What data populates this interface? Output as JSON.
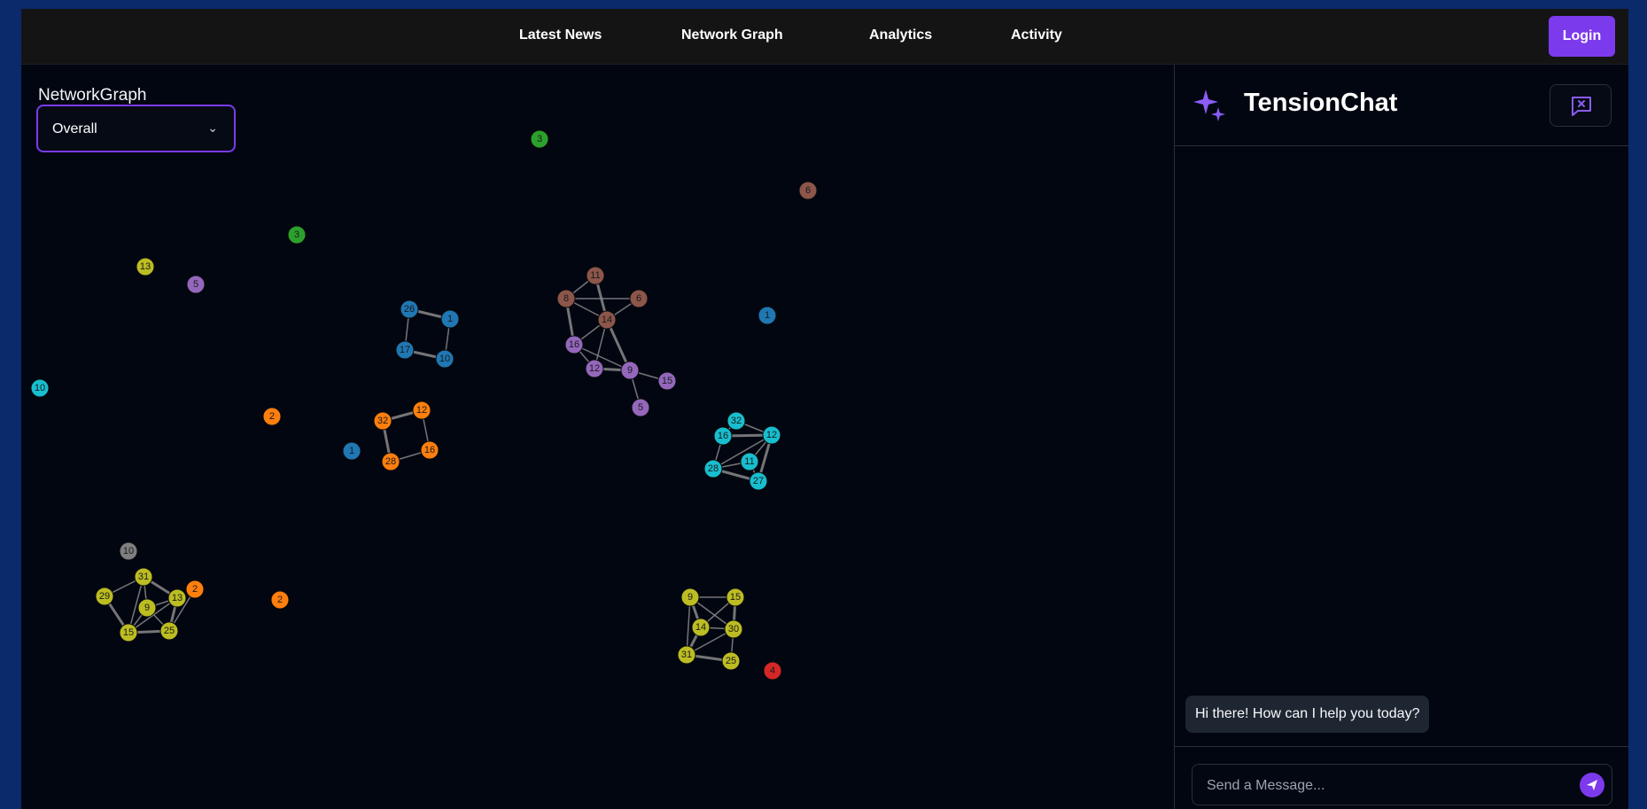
{
  "nav": {
    "links": [
      "Latest News",
      "Network Graph",
      "Analytics",
      "Activity"
    ],
    "login_label": "Login"
  },
  "graph": {
    "title": "NetworkGraph",
    "select": {
      "value": "Overall"
    },
    "colors": {
      "blue": "#1f77b4",
      "orange": "#ff7f0e",
      "green": "#2ca02c",
      "red": "#d62728",
      "purple": "#9467bd",
      "brown": "#8c564b",
      "gray": "#7f7f7f",
      "olive": "#bcbd22",
      "cyan": "#17becf"
    },
    "nodes": [
      {
        "label": "3",
        "color": "green"
      },
      {
        "label": "6",
        "color": "brown"
      },
      {
        "label": "3",
        "color": "green"
      },
      {
        "label": "13",
        "color": "olive"
      },
      {
        "label": "5",
        "color": "purple"
      },
      {
        "label": "10",
        "color": "cyan"
      },
      {
        "label": "26",
        "color": "blue"
      },
      {
        "label": "1",
        "color": "blue"
      },
      {
        "label": "17",
        "color": "blue"
      },
      {
        "label": "10",
        "color": "blue"
      },
      {
        "label": "11",
        "color": "brown"
      },
      {
        "label": "8",
        "color": "brown"
      },
      {
        "label": "6",
        "color": "brown"
      },
      {
        "label": "14",
        "color": "brown"
      },
      {
        "label": "16",
        "color": "purple"
      },
      {
        "label": "12",
        "color": "purple"
      },
      {
        "label": "9",
        "color": "purple"
      },
      {
        "label": "15",
        "color": "purple"
      },
      {
        "label": "5",
        "color": "purple"
      },
      {
        "label": "1",
        "color": "blue"
      },
      {
        "label": "2",
        "color": "orange"
      },
      {
        "label": "32",
        "color": "orange"
      },
      {
        "label": "12",
        "color": "orange"
      },
      {
        "label": "16",
        "color": "orange"
      },
      {
        "label": "28",
        "color": "orange"
      },
      {
        "label": "1",
        "color": "blue"
      },
      {
        "label": "32",
        "color": "cyan"
      },
      {
        "label": "16",
        "color": "cyan"
      },
      {
        "label": "12",
        "color": "cyan"
      },
      {
        "label": "11",
        "color": "cyan"
      },
      {
        "label": "28",
        "color": "cyan"
      },
      {
        "label": "27",
        "color": "cyan"
      },
      {
        "label": "10",
        "color": "gray"
      },
      {
        "label": "31",
        "color": "olive"
      },
      {
        "label": "29",
        "color": "olive"
      },
      {
        "label": "13",
        "color": "olive"
      },
      {
        "label": "2",
        "color": "orange"
      },
      {
        "label": "9",
        "color": "olive"
      },
      {
        "label": "15",
        "color": "olive"
      },
      {
        "label": "25",
        "color": "olive"
      },
      {
        "label": "2",
        "color": "orange"
      },
      {
        "label": "9",
        "color": "olive"
      },
      {
        "label": "15",
        "color": "olive"
      },
      {
        "label": "14",
        "color": "olive"
      },
      {
        "label": "30",
        "color": "olive"
      },
      {
        "label": "31",
        "color": "olive"
      },
      {
        "label": "25",
        "color": "olive"
      },
      {
        "label": "4",
        "color": "red"
      }
    ],
    "edges": [
      [
        6,
        7
      ],
      [
        6,
        8
      ],
      [
        7,
        9
      ],
      [
        8,
        9
      ],
      [
        11,
        10
      ],
      [
        11,
        12
      ],
      [
        10,
        13
      ],
      [
        11,
        13
      ],
      [
        12,
        13
      ],
      [
        11,
        14
      ],
      [
        13,
        14
      ],
      [
        13,
        15
      ],
      [
        13,
        16
      ],
      [
        14,
        15
      ],
      [
        14,
        16
      ],
      [
        15,
        16
      ],
      [
        16,
        17
      ],
      [
        16,
        18
      ],
      [
        21,
        22
      ],
      [
        22,
        23
      ],
      [
        23,
        24
      ],
      [
        24,
        21
      ],
      [
        26,
        27
      ],
      [
        26,
        28
      ],
      [
        27,
        28
      ],
      [
        27,
        30
      ],
      [
        28,
        29
      ],
      [
        28,
        31
      ],
      [
        29,
        30
      ],
      [
        29,
        31
      ],
      [
        30,
        31
      ],
      [
        28,
        30
      ],
      [
        33,
        34
      ],
      [
        33,
        35
      ],
      [
        33,
        37
      ],
      [
        33,
        38
      ],
      [
        34,
        38
      ],
      [
        35,
        37
      ],
      [
        35,
        38
      ],
      [
        35,
        39
      ],
      [
        37,
        38
      ],
      [
        37,
        39
      ],
      [
        38,
        39
      ],
      [
        36,
        39
      ],
      [
        41,
        42
      ],
      [
        41,
        43
      ],
      [
        41,
        44
      ],
      [
        41,
        45
      ],
      [
        42,
        44
      ],
      [
        42,
        43
      ],
      [
        43,
        44
      ],
      [
        43,
        45
      ],
      [
        44,
        45
      ],
      [
        44,
        46
      ],
      [
        45,
        46
      ]
    ]
  },
  "chat": {
    "title": "TensionChat",
    "messages": [
      {
        "role": "bot",
        "text": "Hi there! How can I help you today?"
      }
    ],
    "input_placeholder": "Send a Message...",
    "accent": "#7c3aed"
  }
}
